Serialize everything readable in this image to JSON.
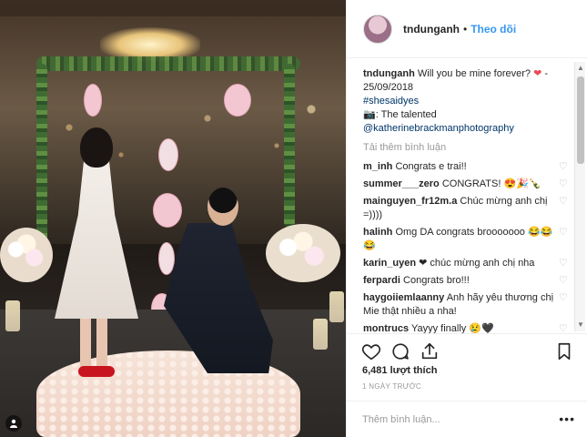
{
  "post": {
    "username": "tndunganh",
    "follow_label": "Theo dõi",
    "separator": "•",
    "caption_text": "Will you be mine forever?",
    "caption_heart": "❤",
    "caption_date": " - 25/09/2018",
    "hashtag": "#shesaidyes",
    "camera_emoji": "📷",
    "credit_prefix": ": The talented",
    "credit_handle": "@katherinebrackmanphotography",
    "load_more": "Tải thêm bình luận",
    "likes": "6,481 lượt thích",
    "time": "1 NGÀY TRƯỚC",
    "add_comment_placeholder": "Thêm bình luận...",
    "more_dots": "•••"
  },
  "comments": [
    {
      "user": "m_inh",
      "text": "Congrats e trai!!"
    },
    {
      "user": "summer___zero",
      "text": "CONGRATS! 😍🎉🍾"
    },
    {
      "user": "mainguyen_fr12m.a",
      "text": "Chúc mừng anh chị =))))"
    },
    {
      "user": "halinh",
      "text": "Omg DA congrats brooooooo 😂😂😂"
    },
    {
      "user": "karin_uyen",
      "text": "❤ chúc mừng anh chị nha"
    },
    {
      "user": "ferpardi",
      "text": "Congrats bro!!!"
    },
    {
      "user": "haygoiiemlaanny",
      "text": "Anh hãy yêu thương chị Mie thật nhiều a nha!"
    },
    {
      "user": "montrucs",
      "text": "Yayyy finally 😢🖤"
    }
  ],
  "icons": {
    "heart": "heart-outline-icon",
    "comment": "comment-bubble-icon",
    "share": "share-icon",
    "save": "bookmark-icon"
  },
  "colors": {
    "link": "#3897f0",
    "hashtag": "#003569",
    "heart": "#ed4956",
    "muted": "#999999"
  }
}
